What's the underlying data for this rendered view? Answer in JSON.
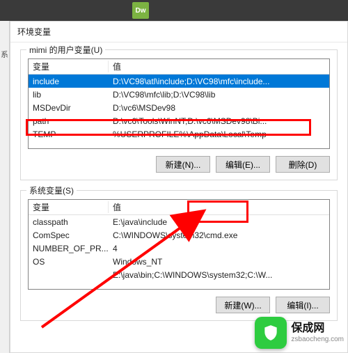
{
  "topbar": {
    "app_icon_text": "Dw"
  },
  "sidebar": {
    "glyph": "系"
  },
  "dialog": {
    "title": "环境变量"
  },
  "user": {
    "title": "mimi 的用户变量(U)",
    "header_var": "变量",
    "header_val": "值",
    "rows": [
      {
        "var": "include",
        "val": "D:\\VC98\\atl\\include;D:\\VC98\\mfc\\include..."
      },
      {
        "var": "lib",
        "val": "D:\\VC98\\mfc\\lib;D:\\VC98\\lib"
      },
      {
        "var": "MSDevDir",
        "val": "D:\\vc6\\MSDev98"
      },
      {
        "var": "path",
        "val": "D:\\vc6\\Tools\\WinNT;D:\\vc6\\MSDev98\\Bi..."
      },
      {
        "var": "TEMP",
        "val": "%USERPROFILE%\\AppData\\Local\\Temp"
      }
    ],
    "btn_new": "新建(N)...",
    "btn_edit": "编辑(E)...",
    "btn_del": "删除(D)"
  },
  "system": {
    "title": "系统变量(S)",
    "header_var": "变量",
    "header_val": "值",
    "rows": [
      {
        "var": "classpath",
        "val": "E:\\java\\include"
      },
      {
        "var": "ComSpec",
        "val": "C:\\WINDOWS\\system32\\cmd.exe"
      },
      {
        "var": "NUMBER_OF_PR...",
        "val": "4"
      },
      {
        "var": "OS",
        "val": "Windows_NT"
      },
      {
        "var": "",
        "val": "E:\\java\\bin;C:\\WINDOWS\\system32;C:\\W..."
      }
    ],
    "btn_new": "新建(W)...",
    "btn_edit": "编辑(I)..."
  },
  "watermark": {
    "title": "保成网",
    "sub": "zsbaocheng.com"
  }
}
